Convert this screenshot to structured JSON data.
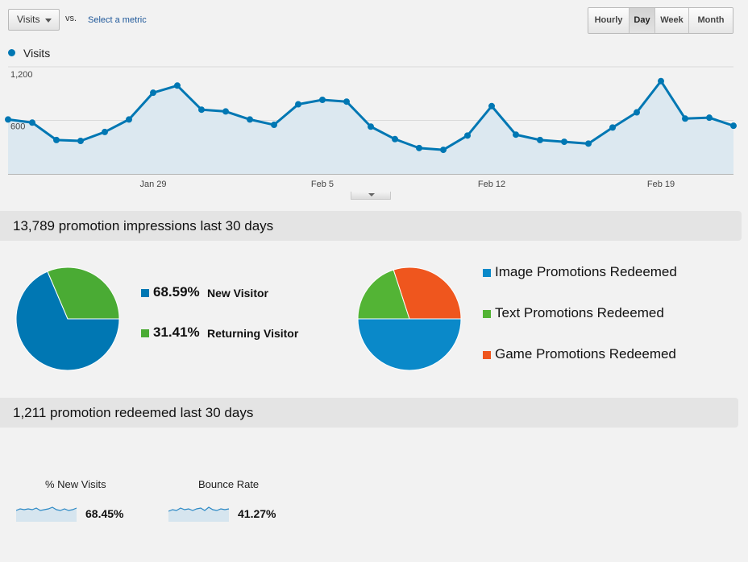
{
  "toolbar": {
    "metric_selected": "Visits",
    "vs_label": "vs.",
    "select_metric_link": "Select a metric",
    "granularity": [
      {
        "label": "Hourly",
        "active": false
      },
      {
        "label": "Day",
        "active": true
      },
      {
        "label": "Week",
        "active": false
      },
      {
        "label": "Month",
        "active": false
      }
    ]
  },
  "chart_data": {
    "type": "area",
    "series": [
      {
        "name": "Visits",
        "color": "#0077b3",
        "values": [
          610,
          575,
          380,
          370,
          470,
          610,
          910,
          990,
          720,
          700,
          610,
          550,
          780,
          830,
          810,
          530,
          390,
          290,
          270,
          430,
          760,
          440,
          380,
          360,
          340,
          520,
          690,
          1040,
          620,
          630,
          540
        ]
      }
    ],
    "x_tick_labels": [
      "Jan 29",
      "Feb 5",
      "Feb 12",
      "Feb 19"
    ],
    "x_tick_indices": [
      6,
      13,
      20,
      27
    ],
    "y_tick_labels": [
      "1,200",
      "600"
    ],
    "y_tick_values": [
      1200,
      600
    ],
    "ylim": [
      0,
      1200
    ],
    "grid": true,
    "legend": "top-left",
    "fill_color": "#dce8f0"
  },
  "impressions": {
    "title": "13,789 promotion impressions last 30 days",
    "visitor_pie": {
      "slices": [
        {
          "label": "New Visitor",
          "percent_text": "68.59%",
          "value": 68.59,
          "color": "#0077b3"
        },
        {
          "label": "Returning Visitor",
          "percent_text": "31.41%",
          "value": 31.41,
          "color": "#4aab34"
        }
      ]
    },
    "promo_pie": {
      "slices": [
        {
          "label": "Image Promotions Redeemed",
          "value": 50,
          "color": "#0a89c9"
        },
        {
          "label": "Text Promotions Redeemed",
          "value": 20,
          "color": "#53b435"
        },
        {
          "label": "Game Promotions Redeemed",
          "value": 30,
          "color": "#ef561e"
        }
      ]
    }
  },
  "redeemed": {
    "title": "1,211 promotion redeemed last 30 days",
    "metrics": [
      {
        "title": "% New Visits",
        "value": "68.45%"
      },
      {
        "title": "Bounce Rate",
        "value": "41.27%"
      }
    ]
  }
}
